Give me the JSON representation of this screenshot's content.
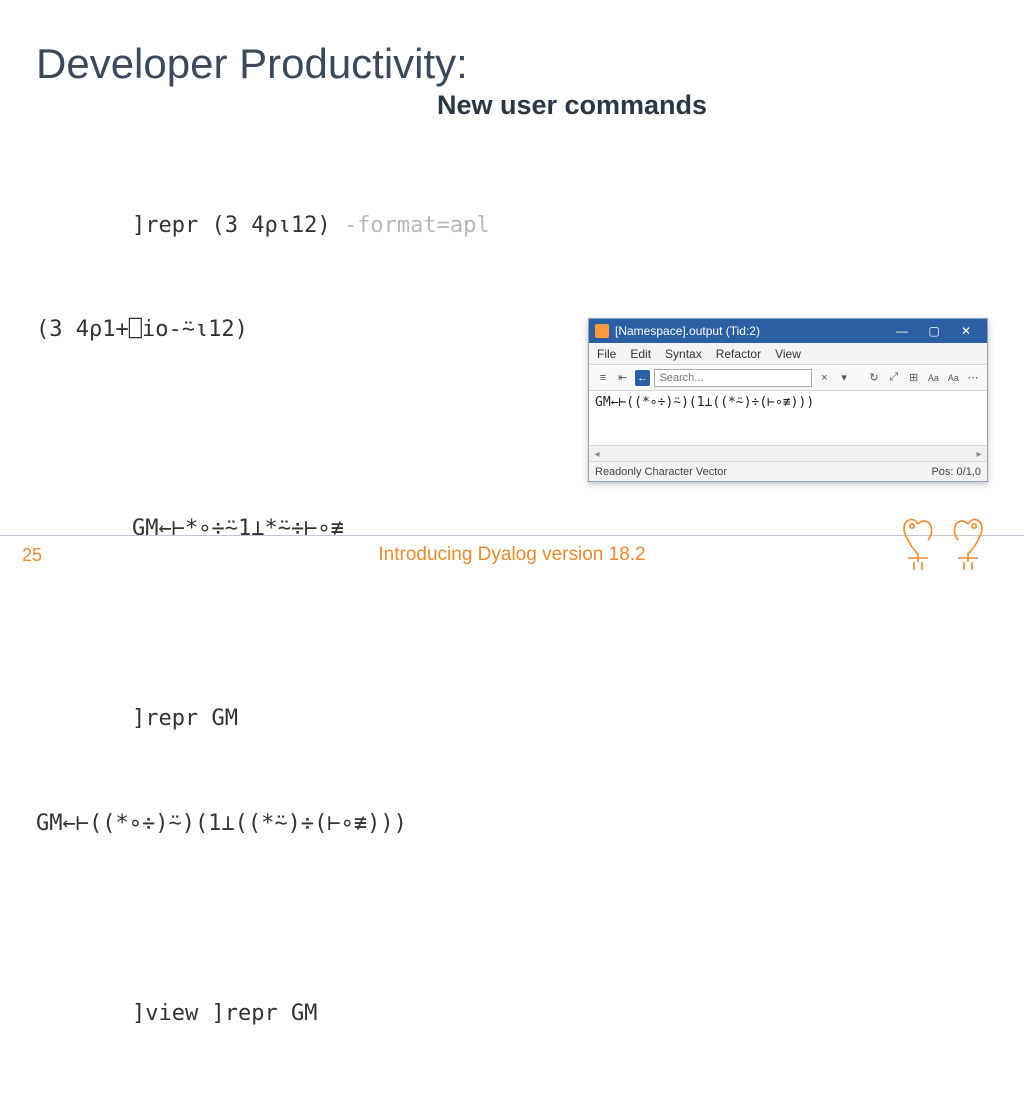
{
  "title": "Developer Productivity:",
  "subtitle": "New user commands",
  "code": {
    "l1a": "]repr (3 4⍴⍳12) ",
    "l1b": "-format=apl",
    "l2": "(3 4⍴1+⎕io-⍨⍳12)",
    "l3": "GM←⊢*∘÷⍨1⊥*⍨÷⊢∘≢",
    "l4": "]repr GM",
    "l5": "GM←⊢((*∘÷)⍨)(1⊥((*⍨)÷(⊢∘≢)))",
    "l6": "]view ]repr GM"
  },
  "editor": {
    "title": "[Namespace].output (Tid:2)",
    "menu": [
      "File",
      "Edit",
      "Syntax",
      "Refactor",
      "View"
    ],
    "search_placeholder": "Search...",
    "content": " GM←⊢((*∘÷)⍨)(1⊥((*⍨)÷(⊢∘≢)))",
    "status_left": "Readonly Character Vector",
    "status_right": "Pos: 0/1,0"
  },
  "footer": {
    "page": "25",
    "text": "Introducing Dyalog version 18.2"
  }
}
